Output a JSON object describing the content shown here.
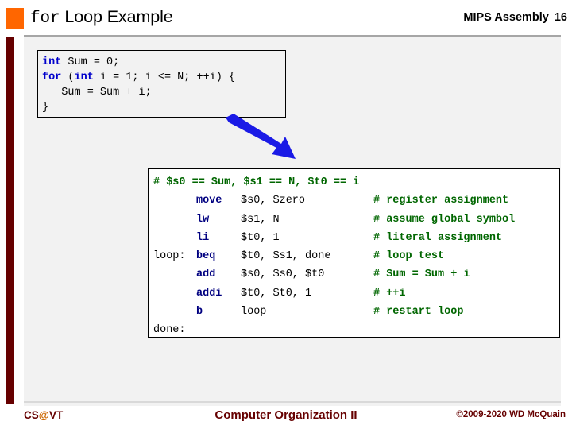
{
  "header": {
    "bullet_color": "#FF6600",
    "title_mono": "for",
    "title_rest": " Loop Example",
    "topic": "MIPS Assembly",
    "page_number": "16"
  },
  "c_code": {
    "lines": [
      [
        {
          "t": "int",
          "k": true
        },
        {
          "t": " Sum = 0;",
          "k": false
        }
      ],
      [
        {
          "t": "for",
          "k": true
        },
        {
          "t": " (",
          "k": false
        },
        {
          "t": "int",
          "k": true
        },
        {
          "t": " i = 1; i <= N; ++i) {",
          "k": false
        }
      ],
      [
        {
          "t": "   Sum = Sum + i;",
          "k": false
        }
      ],
      [
        {
          "t": "}",
          "k": false
        }
      ]
    ]
  },
  "arrow": {
    "color": "#1A1AE6",
    "direction": "down-right"
  },
  "assembly": {
    "header_comment": "# $s0 == Sum, $s1 == N, $t0 == i",
    "rows": [
      {
        "label": "",
        "op": "move",
        "args": "$s0, $zero",
        "comment": "# register assignment"
      },
      {
        "label": "",
        "op": "lw",
        "args": "$s1, N",
        "comment": "# assume global symbol"
      },
      {
        "label": "",
        "op": "li",
        "args": "$t0, 1",
        "comment": "# literal assignment"
      },
      {
        "label": "loop:",
        "op": "beq",
        "args": "$t0, $s1, done",
        "comment": "# loop test"
      },
      {
        "label": "",
        "op": "add",
        "args": "$s0, $s0, $t0",
        "comment": "# Sum = Sum + i"
      },
      {
        "label": "",
        "op": "addi",
        "args": "$t0, $t0, 1",
        "comment": "# ++i"
      },
      {
        "label": "",
        "op": "b",
        "args": "loop",
        "comment": "# restart loop"
      }
    ],
    "end_label": "done:"
  },
  "footer": {
    "logo_pre": "CS",
    "logo_at": "@",
    "logo_post": "VT",
    "center": "Computer Organization II",
    "copyright": "©2009-2020 WD McQuain"
  },
  "colors": {
    "accent_orange": "#FF6600",
    "maroon": "#660000",
    "keyword_blue": "#0000CC",
    "instruction_blue": "#000080",
    "comment_green": "#006600",
    "arrow_blue": "#1A1AE6",
    "panel_gray": "#F2F2F2"
  }
}
